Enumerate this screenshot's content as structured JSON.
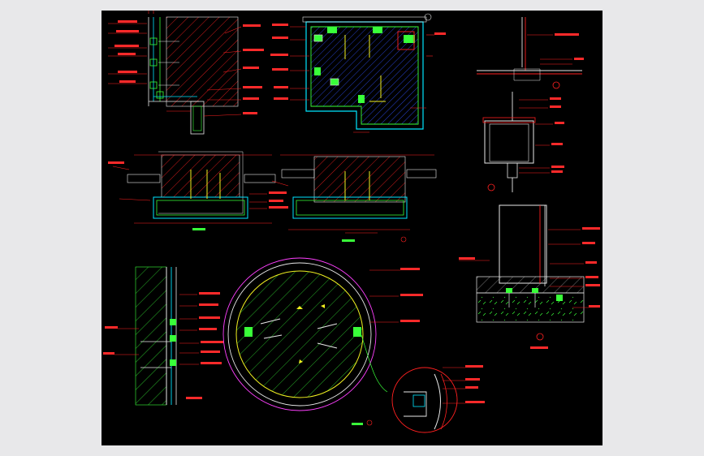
{
  "drawing": {
    "background": "#000000",
    "viewport_background": "#e8e8ea",
    "colors": {
      "dimension": "#ff2020",
      "outline": "#e8e8e8",
      "detail": "#39ff39",
      "profile": "#00e5ff",
      "hatch_blue": "#3050ff",
      "hatch_yellow": "#f0f020",
      "accent": "#ff40ff"
    },
    "icons": [
      "section-marker-icon",
      "anchor-bolt-icon",
      "callout-circle-icon"
    ],
    "views": [
      {
        "id": "corner-joint-detail",
        "hatch": "red"
      },
      {
        "id": "column-section-detail",
        "hatch": "blue"
      },
      {
        "id": "parapet-profile-detail",
        "hatch": "none"
      },
      {
        "id": "horizontal-section-left",
        "hatch": "red"
      },
      {
        "id": "horizontal-section-center",
        "hatch": "red"
      },
      {
        "id": "vertical-mullion-detail",
        "hatch": "none"
      },
      {
        "id": "wall-cladding-section",
        "hatch": "green"
      },
      {
        "id": "circular-column-plan",
        "hatch": "green"
      },
      {
        "id": "circular-column-enlarged-callout",
        "hatch": "none"
      },
      {
        "id": "base-footing-section",
        "hatch": "grey"
      }
    ]
  }
}
